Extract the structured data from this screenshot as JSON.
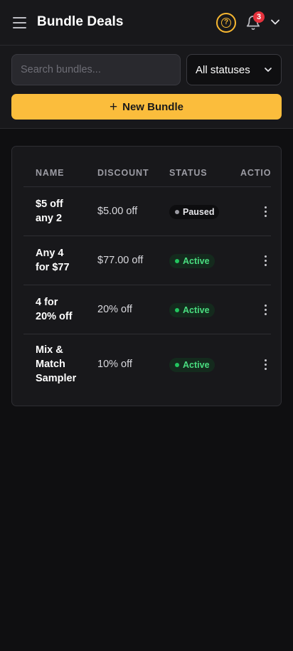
{
  "header": {
    "title": "Bundle Deals",
    "notification_count": "3",
    "icons": {
      "menu": "hamburger-icon",
      "help": "help-icon",
      "bell": "bell-icon",
      "account": "chevron-down-icon"
    },
    "accent_color": "#f7b731"
  },
  "toolbar": {
    "search": {
      "placeholder": "Search bundles...",
      "value": ""
    },
    "status_filter": {
      "selected": "All statuses"
    },
    "new_button": {
      "label": "New Bundle",
      "icon": "plus-icon"
    }
  },
  "table": {
    "columns": [
      "NAME",
      "DISCOUNT",
      "STATUS",
      "ACTIO"
    ],
    "rows": [
      {
        "name_lines": [
          "$5 off",
          "any 2"
        ],
        "discount": "$5.00 off",
        "status": "Paused"
      },
      {
        "name_lines": [
          "Any 4",
          "for $77"
        ],
        "discount": "$77.00 off",
        "status": "Active"
      },
      {
        "name_lines": [
          "4 for",
          "20% off"
        ],
        "discount": "20% off",
        "status": "Active"
      },
      {
        "name_lines": [
          "Mix &",
          "Match",
          "Sampler"
        ],
        "discount": "10% off",
        "status": "Active"
      }
    ]
  },
  "colors": {
    "active": "#22c55e",
    "paused": "#9a9aa2",
    "badge": "#e5323d",
    "primary_button": "#fbbd3c"
  }
}
